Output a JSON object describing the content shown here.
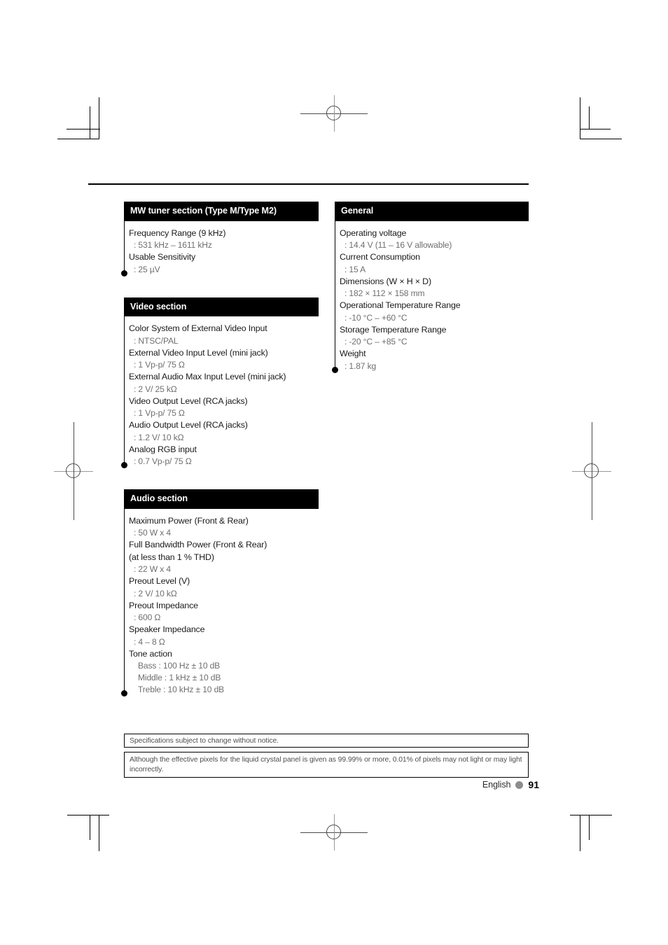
{
  "page": {
    "language": "English",
    "page_number": "91"
  },
  "columns": {
    "left": [
      {
        "title": "MW tuner section (Type M/Type M2)",
        "specs": [
          {
            "label": "Frequency Range (9 kHz)",
            "values": [
              ": 531 kHz – 1611 kHz"
            ]
          },
          {
            "label": "Usable Sensitivity",
            "values": [
              ": 25 µV"
            ]
          }
        ]
      },
      {
        "title": "Video section",
        "specs": [
          {
            "label": "Color System of External Video Input",
            "values": [
              ": NTSC/PAL"
            ]
          },
          {
            "label": "External Video Input Level (mini jack)",
            "values": [
              ": 1 Vp-p/ 75 Ω"
            ]
          },
          {
            "label": "External Audio Max Input Level (mini jack)",
            "values": [
              ": 2 V/ 25 kΩ"
            ]
          },
          {
            "label": "Video Output Level (RCA jacks)",
            "values": [
              ": 1 Vp-p/ 75 Ω"
            ]
          },
          {
            "label": "Audio Output Level (RCA jacks)",
            "values": [
              ": 1.2 V/ 10 kΩ"
            ]
          },
          {
            "label": "Analog RGB input",
            "values": [
              ": 0.7 Vp-p/ 75 Ω"
            ]
          }
        ]
      },
      {
        "title": "Audio section",
        "specs": [
          {
            "label": "Maximum Power (Front & Rear)",
            "values": [
              ": 50 W x 4"
            ]
          },
          {
            "label": "Full Bandwidth Power (Front & Rear)",
            "label2": "(at less than 1 % THD)",
            "values": [
              ": 22 W x 4"
            ]
          },
          {
            "label": "Preout Level (V)",
            "values": [
              ": 2 V/ 10 kΩ"
            ]
          },
          {
            "label": "Preout Impedance",
            "values": [
              ": 600 Ω"
            ]
          },
          {
            "label": "Speaker Impedance",
            "values": [
              ": 4 – 8 Ω"
            ]
          },
          {
            "label": "Tone action",
            "values": [
              "Bass : 100 Hz ± 10 dB",
              "Middle : 1 kHz ± 10 dB",
              "Treble : 10 kHz ± 10 dB"
            ],
            "sub": true
          }
        ]
      }
    ],
    "right": [
      {
        "title": "General",
        "specs": [
          {
            "label": "Operating voltage",
            "values": [
              ": 14.4 V (11 – 16 V allowable)"
            ]
          },
          {
            "label": "Current Consumption",
            "values": [
              ": 15 A"
            ]
          },
          {
            "label": "Dimensions (W × H × D)",
            "values": [
              ": 182 × 112 × 158 mm"
            ]
          },
          {
            "label": "Operational Temperature Range",
            "values": [
              ": -10 °C – +60 °C"
            ]
          },
          {
            "label": "Storage Temperature Range",
            "values": [
              ": -20 °C – +85 °C"
            ]
          },
          {
            "label": "Weight",
            "values": [
              ": 1.87 kg"
            ]
          }
        ]
      }
    ]
  },
  "notes": [
    "Specifications subject to change without notice.",
    "Although the effective pixels for the liquid crystal panel is given as 99.99% or more, 0.01% of pixels may not light or may light incorrectly."
  ]
}
